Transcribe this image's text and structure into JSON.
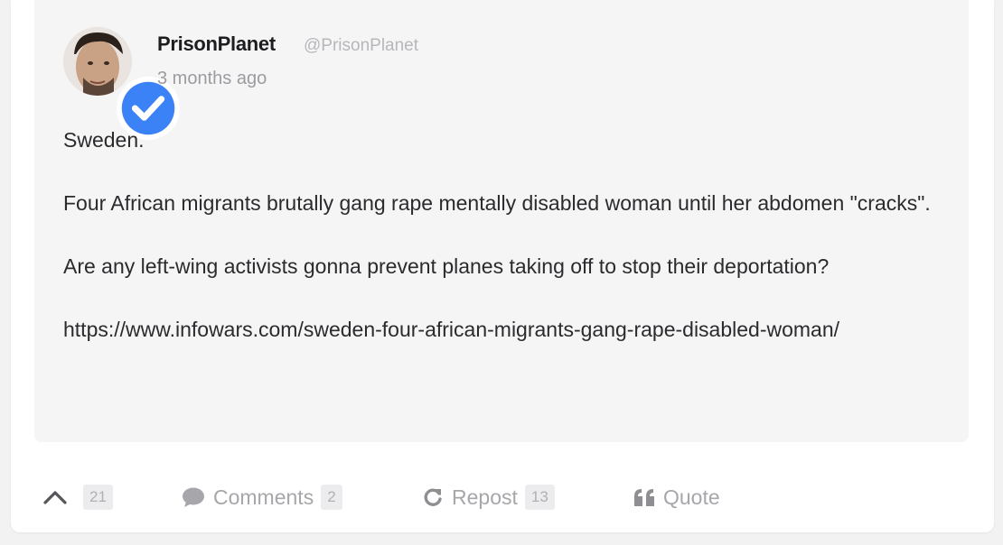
{
  "post": {
    "author_name": "PrisonPlanet",
    "author_handle": "@PrisonPlanet",
    "time_ago": "3 months ago",
    "paragraphs": [
      "Sweden.",
      "Four African migrants brutally gang rape mentally disabled woman until her abdomen \"cracks\".",
      "Are any left-wing activists gonna prevent planes taking off to stop their deportation?",
      "https://www.infowars.com/sweden-four-african-migrants-gang-rape-disabled-woman/"
    ]
  },
  "actions": {
    "upvote_count": "21",
    "comments_label": "Comments",
    "comments_count": "2",
    "repost_label": "Repost",
    "repost_count": "13",
    "quote_label": "Quote"
  },
  "icons": {
    "upvote": "chevron-up-icon",
    "comments": "speech-bubble-icon",
    "repost": "refresh-icon",
    "quote": "quote-marks-icon",
    "verified": "verified-check-icon"
  },
  "colors": {
    "verified_badge": "#3b82f6",
    "muted_text": "#a7a7ab",
    "body_text": "#2b2b2e"
  }
}
